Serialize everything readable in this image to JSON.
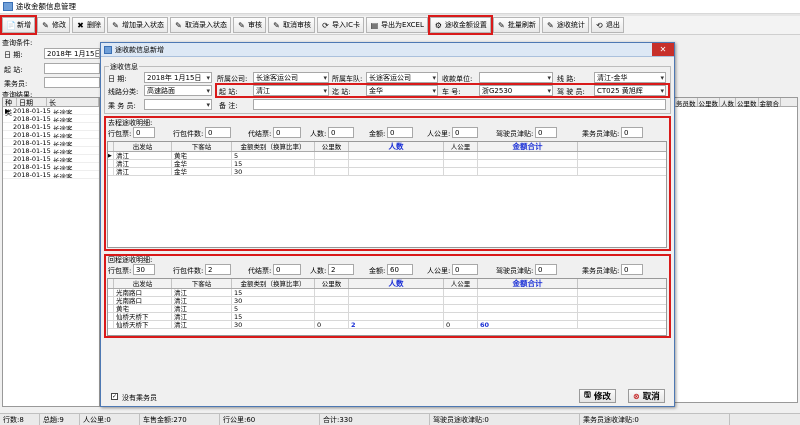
{
  "window": {
    "title": "途收金额信息管理"
  },
  "toolbar": [
    {
      "name": "add-button",
      "label": "新增",
      "icon": "📄",
      "hl": true
    },
    {
      "name": "edit-button",
      "label": "修改",
      "icon": "✎"
    },
    {
      "name": "delete-button",
      "label": "删除",
      "icon": "✖"
    },
    {
      "name": "add-entry-state-button",
      "label": "增加录入状态",
      "icon": "✎"
    },
    {
      "name": "cancel-entry-state-button",
      "label": "取消录入状态",
      "icon": "✎"
    },
    {
      "name": "audit-button",
      "label": "审核",
      "icon": "✎"
    },
    {
      "name": "cancel-audit-button",
      "label": "取消审核",
      "icon": "✎"
    },
    {
      "name": "import-ic-button",
      "label": "导入IC卡",
      "icon": "⟳"
    },
    {
      "name": "export-excel-button",
      "label": "导出为EXCEL",
      "icon": "▤"
    },
    {
      "name": "amount-settings-button",
      "label": "途收金额设置",
      "icon": "⚙",
      "hl": true
    },
    {
      "name": "batch-refresh-button",
      "label": "批量刷新",
      "icon": "✎"
    },
    {
      "name": "stats-button",
      "label": "途收统计",
      "icon": "✎"
    },
    {
      "name": "exit-button",
      "label": "退出",
      "icon": "⟲"
    }
  ],
  "query": {
    "section_label": "查询条件:",
    "date_label": "日    期:",
    "date_value": "2018年 1月15日",
    "start_label": "起    站:",
    "crew_label": "乘务员:",
    "result_label": "查询结果:"
  },
  "bg_grid": {
    "headers": [
      "种类",
      "日期",
      "长"
    ],
    "rows": [
      [
        "2018-01-15",
        "长途客"
      ],
      [
        "2018-01-15",
        "长途客"
      ],
      [
        "2018-01-15",
        "长途客"
      ],
      [
        "2018-01-15",
        "长途客"
      ],
      [
        "2018-01-15",
        "长途客"
      ],
      [
        "2018-01-15",
        "长途客"
      ],
      [
        "2018-01-15",
        "长途客"
      ],
      [
        "2018-01-15",
        "长途客"
      ],
      [
        "2018-01-15",
        "长途客"
      ]
    ]
  },
  "right_grid_headers": [
    "务员数",
    "公里数",
    "人数",
    "公里数",
    "金额合"
  ],
  "statusbar": [
    "行数:8",
    "总趟:9",
    "人公里:0",
    "车售金额:270",
    "行公里:60",
    "合计:330",
    "驾驶员途收津贴:0",
    "乘务员途收津贴:0"
  ],
  "dialog": {
    "title": "途收款信息新增",
    "info_legend": "途收信息",
    "fields": {
      "date_label": "日    期:",
      "date_value": "2018年 1月15日",
      "company_label": "所属公司:",
      "company_value": "长途客运公司",
      "fleet_label": "所属车队:",
      "fleet_value": "长途客运公司",
      "payee_label": "收款单位:",
      "payee_value": "",
      "line_label": "线    路:",
      "line_value": "清江-金华",
      "line_type_label": "线路分类:",
      "line_type_value": "高速路面",
      "start_label": "起    站:",
      "start_value": "清江",
      "end_label": "迄    站:",
      "end_value": "金华",
      "plate_label": "车    号:",
      "plate_value": "浙G2530",
      "driver_label": "驾 驶 员:",
      "driver_value": "CT025  黄旭辉",
      "crew_label": "乘 务 员:",
      "crew_value": "",
      "note_label": "备    注:",
      "note_value": ""
    },
    "outbound": {
      "legend": "去程途收明细:",
      "summary": [
        {
          "label": "行包票:",
          "value": "0"
        },
        {
          "label": "行包件数:",
          "value": "0"
        },
        {
          "label": "代结票:",
          "value": "0"
        },
        {
          "label": "人数:",
          "value": "0"
        },
        {
          "label": "金额:",
          "value": "0"
        },
        {
          "label": "人公里:",
          "value": "0"
        },
        {
          "label": "驾驶员津贴:",
          "value": "0"
        },
        {
          "label": "乘务员津贴:",
          "value": "0"
        }
      ],
      "headers": [
        "出发站",
        "下客站",
        "金额类别（换算比率）",
        "公里数",
        "人数",
        "人公里",
        "金额合计"
      ],
      "rows": [
        {
          "marker": "▶",
          "c": [
            "清江",
            "黄宅",
            "5",
            "",
            "",
            "",
            ""
          ]
        },
        {
          "marker": "",
          "c": [
            "清江",
            "金华",
            "15",
            "",
            "",
            "",
            ""
          ]
        },
        {
          "marker": "",
          "c": [
            "清江",
            "金华",
            "30",
            "",
            "",
            "",
            ""
          ]
        }
      ]
    },
    "return": {
      "legend": "回程途收明细:",
      "summary": [
        {
          "label": "行包票:",
          "value": "30"
        },
        {
          "label": "行包件数:",
          "value": "2"
        },
        {
          "label": "代结票:",
          "value": "0"
        },
        {
          "label": "人数:",
          "value": "2"
        },
        {
          "label": "金额:",
          "value": "60"
        },
        {
          "label": "人公里:",
          "value": "0"
        },
        {
          "label": "驾驶员津贴:",
          "value": "0"
        },
        {
          "label": "乘务员津贴:",
          "value": "0"
        }
      ],
      "headers": [
        "出发站",
        "下客站",
        "金额类别（换算比率）",
        "公里数",
        "人数",
        "人公里",
        "金额合计"
      ],
      "rows": [
        {
          "marker": "",
          "c": [
            "光南路口",
            "清江",
            "15",
            "",
            "",
            "",
            ""
          ]
        },
        {
          "marker": "",
          "c": [
            "光南路口",
            "清江",
            "30",
            "",
            "",
            "",
            ""
          ]
        },
        {
          "marker": "",
          "c": [
            "黄宅",
            "清江",
            "5",
            "",
            "",
            "",
            ""
          ]
        },
        {
          "marker": "",
          "c": [
            "仙桥天桥下",
            "清江",
            "15",
            "",
            "",
            "",
            ""
          ]
        },
        {
          "marker": "",
          "c": [
            "仙桥天桥下",
            "清江",
            "30",
            "0",
            "2",
            "0",
            "60"
          ]
        }
      ]
    },
    "no_crew_label": "没有乘务员",
    "no_crew_checked": true,
    "edit_button": "修改",
    "cancel_button": "取消"
  }
}
